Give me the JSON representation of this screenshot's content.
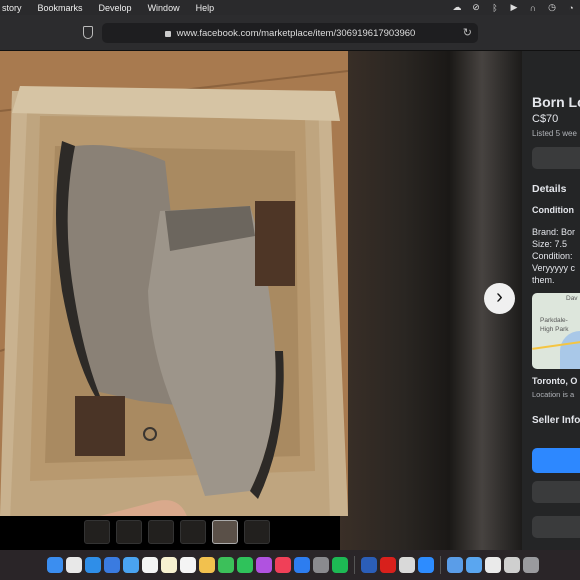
{
  "menubar": {
    "items": [
      "story",
      "Bookmarks",
      "Develop",
      "Window",
      "Help"
    ],
    "status_icons": [
      "creative-cloud-icon",
      "sync-icon",
      "bluetooth-icon",
      "play-icon",
      "headphones-icon",
      "timemachine-icon",
      "bell-icon"
    ]
  },
  "browser": {
    "url": "www.facebook.com/marketplace/item/306919617903960",
    "reload_glyph": "↻"
  },
  "viewer": {
    "next_glyph": "›",
    "thumbnail_count": 6,
    "active_thumbnail": 5
  },
  "listing": {
    "title": "Born Lo",
    "price": "C$70",
    "listed": "Listed 5 wee",
    "details_heading": "Details",
    "condition_heading": "Condition",
    "description_lines": [
      "Brand: Bor",
      "Size: 7.5",
      "Condition:",
      "Veryyyyy c",
      "them."
    ],
    "map_labels": [
      "Dav",
      "Parkdale-",
      "High Park"
    ],
    "location": "Toronto, O",
    "location_note": "Location is a",
    "seller_heading": "Seller Info"
  },
  "dock": {
    "apps": [
      {
        "name": "finder",
        "color": "#3b8ef0"
      },
      {
        "name": "chrome",
        "color": "#e8e8e8"
      },
      {
        "name": "safari",
        "color": "#2f8ee8"
      },
      {
        "name": "appstore-like",
        "color": "#3a7be0"
      },
      {
        "name": "mail",
        "color": "#4aa3f0"
      },
      {
        "name": "calendar",
        "color": "#f4f4f4"
      },
      {
        "name": "notes",
        "color": "#f7f1d0"
      },
      {
        "name": "reminders",
        "color": "#f4f4f4"
      },
      {
        "name": "photos",
        "color": "#f2c14e"
      },
      {
        "name": "facetime",
        "color": "#3cc05a"
      },
      {
        "name": "whatsapp",
        "color": "#2fc25b"
      },
      {
        "name": "podcasts",
        "color": "#b052e0"
      },
      {
        "name": "music",
        "color": "#f04058"
      },
      {
        "name": "app-store",
        "color": "#2d7df0"
      },
      {
        "name": "settings",
        "color": "#8a8a8e"
      },
      {
        "name": "spotify",
        "color": "#1db954"
      },
      {
        "name": "word",
        "color": "#2b5eb8"
      },
      {
        "name": "acrobat",
        "color": "#d8201c"
      },
      {
        "name": "preview",
        "color": "#d9d9d9"
      },
      {
        "name": "zoom",
        "color": "#2d8cff"
      },
      {
        "name": "downloads",
        "color": "#5a9de8"
      },
      {
        "name": "folder",
        "color": "#5aa6f0"
      },
      {
        "name": "document",
        "color": "#eaeaea"
      },
      {
        "name": "document2",
        "color": "#cfcfcf"
      },
      {
        "name": "trash",
        "color": "#9a9a9e"
      }
    ]
  }
}
